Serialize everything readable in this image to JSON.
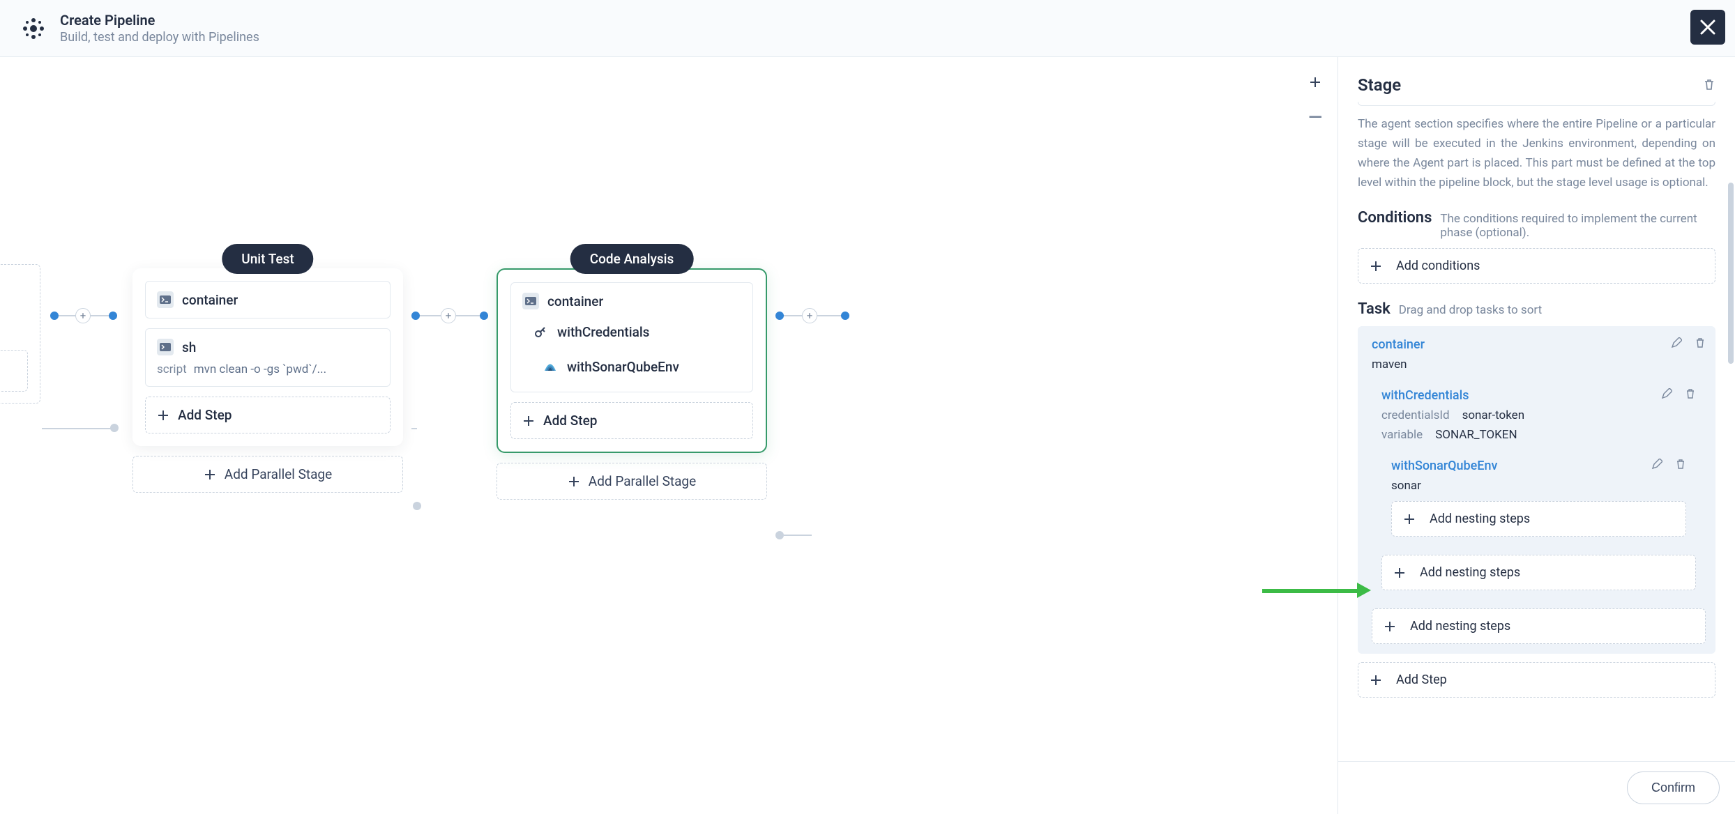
{
  "header": {
    "title": "Create Pipeline",
    "subtitle": "Build, test and deploy with Pipelines"
  },
  "zoom": {
    "in": "+",
    "out": "−"
  },
  "stages": {
    "unit_test": {
      "label": "Unit Test",
      "step1_name": "container",
      "step2_name": "sh",
      "step2_k": "script",
      "step2_v": "mvn clean -o -gs `pwd`/...",
      "add_step": "Add Step",
      "add_parallel": "Add Parallel Stage"
    },
    "code_analysis": {
      "label": "Code Analysis",
      "step1_name": "container",
      "step2_name": "withCredentials",
      "step3_name": "withSonarQubeEnv",
      "add_step": "Add Step",
      "add_parallel": "Add Parallel Stage"
    }
  },
  "panel": {
    "stage_heading": "Stage",
    "agent_desc": "The agent section specifies where the entire Pipeline or a particular stage will be executed in the Jenkins environment, depending on where the Agent part is placed. This part must be defined at the top level within the pipeline block, but the stage level usage is optional.",
    "conditions_heading": "Conditions",
    "conditions_sub": "The conditions required to implement the current phase (optional).",
    "add_conditions": "Add conditions",
    "task_heading": "Task",
    "task_sub": "Drag and drop tasks to sort",
    "task1": {
      "name": "container",
      "val": "maven"
    },
    "task2": {
      "name": "withCredentials",
      "kv1_k": "credentialsId",
      "kv1_v": "sonar-token",
      "kv2_k": "variable",
      "kv2_v": "SONAR_TOKEN"
    },
    "task3": {
      "name": "withSonarQubeEnv",
      "val": "sonar"
    },
    "add_nesting": "Add nesting steps",
    "add_step": "Add Step",
    "confirm": "Confirm"
  }
}
